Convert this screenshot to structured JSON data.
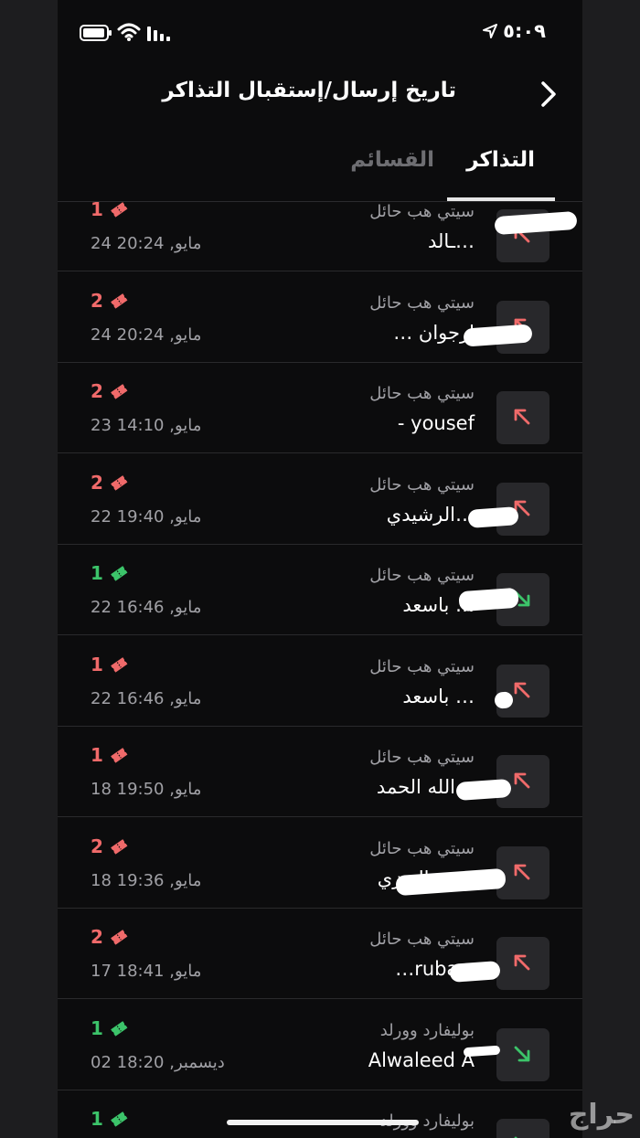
{
  "status_bar": {
    "time": "٥:٠٩"
  },
  "header": {
    "title": "تاريخ إرسال/إستقبال التذاكر"
  },
  "tabs": {
    "active": "التذاكر",
    "inactive": "القسائم"
  },
  "rows": [
    {
      "event": "سيتي هب حائل",
      "name": "…ـالد",
      "date": "24 مايو, 20:24",
      "count": "1",
      "dir": "sent",
      "color": "#f06a6a"
    },
    {
      "event": "سيتي هب حائل",
      "name": "ارجوان …",
      "date": "24 مايو, 20:24",
      "count": "2",
      "dir": "sent",
      "color": "#f06a6a"
    },
    {
      "event": "سيتي هب حائل",
      "name": "yousef -",
      "date": "23 مايو, 14:10",
      "count": "2",
      "dir": "sent",
      "color": "#f06a6a"
    },
    {
      "event": "سيتي هب حائل",
      "name": "…الرشيدي",
      "date": "22 مايو, 19:40",
      "count": "2",
      "dir": "sent",
      "color": "#f06a6a"
    },
    {
      "event": "سيتي هب حائل",
      "name": "… باسعد",
      "date": "22 مايو, 16:46",
      "count": "1",
      "dir": "received",
      "color": "#3cc46a"
    },
    {
      "event": "سيتي هب حائل",
      "name": "… باسعد",
      "date": "22 مايو, 16:46",
      "count": "1",
      "dir": "sent",
      "color": "#f06a6a"
    },
    {
      "event": "سيتي هب حائل",
      "name": "…الله الحمد",
      "date": "18 مايو, 19:50",
      "count": "1",
      "dir": "sent",
      "color": "#f06a6a"
    },
    {
      "event": "سيتي هب حائل",
      "name": "…ين العنزي",
      "date": "18 مايو, 19:36",
      "count": "2",
      "dir": "sent",
      "color": "#f06a6a"
    },
    {
      "event": "سيتي هب حائل",
      "name": "ruba s…",
      "date": "17 مايو, 18:41",
      "count": "2",
      "dir": "sent",
      "color": "#f06a6a"
    },
    {
      "event": "بوليفارد وورلد",
      "name": "Alwaleed A",
      "date": "02 ديسمبر, 18:20",
      "count": "1",
      "dir": "received",
      "color": "#3cc46a"
    },
    {
      "event": "بوليفارد وورلد",
      "name": "",
      "date": "",
      "count": "1",
      "dir": "received",
      "color": "#3cc46a"
    }
  ],
  "watermark": "حراج"
}
